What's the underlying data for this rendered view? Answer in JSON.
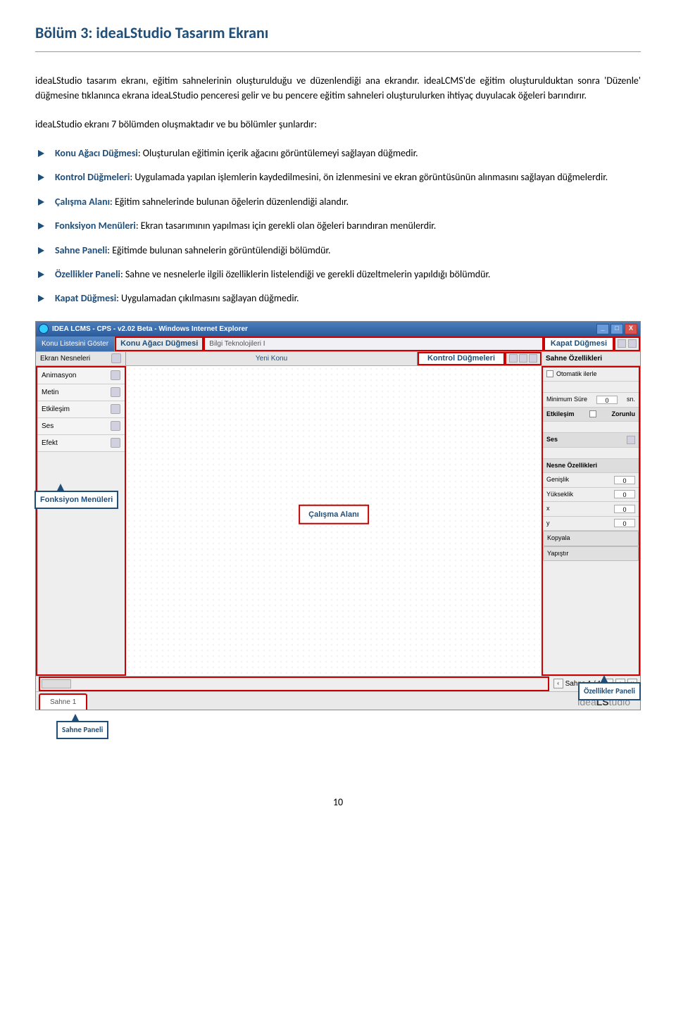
{
  "heading": "Bölüm 3: ideaLStudio Tasarım Ekranı",
  "p1": "ideaLStudio tasarım ekranı, eğitim sahnelerinin oluşturulduğu ve düzenlendiği ana ekrandır. ideaLCMS'de eğitim oluşturulduktan sonra 'Düzenle' düğmesine tıklanınca ekrana ideaLStudio penceresi gelir ve bu pencere eğitim sahneleri oluşturulurken ihtiyaç duyulacak öğeleri barındırır.",
  "p2": "ideaLStudio ekranı 7 bölümden oluşmaktadır ve bu bölümler şunlardır:",
  "items": {
    "0": {
      "term": "Konu Ağacı Düğmesi",
      "desc": ": Oluşturulan eğitimin içerik ağacını görüntülemeyi sağlayan düğmedir."
    },
    "1": {
      "term": "Kontrol Düğmeleri",
      "desc": ": Uygulamada yapılan işlemlerin kaydedilmesini, ön izlenmesini ve ekran görüntüsünün alınmasını sağlayan düğmelerdir."
    },
    "2": {
      "term": "Çalışma Alanı",
      "desc": ": Eğitim sahnelerinde bulunan öğelerin düzenlendiği alandır."
    },
    "3": {
      "term": "Fonksiyon Menüleri",
      "desc": ": Ekran tasarımının yapılması için gerekli olan öğeleri barındıran menülerdir."
    },
    "4": {
      "term": "Sahne Paneli",
      "desc": ": Eğitimde bulunan sahnelerin görüntülendiği bölümdür."
    },
    "5": {
      "term": "Özellikler Paneli",
      "desc": ": Sahne ve nesnelerle ilgili özelliklerin listelendiği ve gerekli düzeltmelerin yapıldığı bölümdür."
    },
    "6": {
      "term": "Kapat Düğmesi",
      "desc": ": Uygulamadan çıkılmasını sağlayan düğmedir."
    }
  },
  "win": {
    "title": "IDEA LCMS - CPS - v2.02 Beta - Windows Internet Explorer",
    "min": "_",
    "max": "□",
    "close": "X"
  },
  "tb1": {
    "konu_liste": "Konu Listesini Göster",
    "konu_agaci": "Konu Ağacı Düğmesi",
    "bilgi": "Bilgi Teknolojileri I",
    "kapat": "Kapat Düğmesi"
  },
  "tb2": {
    "ekran": "Ekran Nesneleri",
    "yeni": "Yeni Konu",
    "kontrol": "Kontrol Düğmeleri",
    "sahne_oz": "Sahne Özellikleri"
  },
  "side": {
    "0": "Animasyon",
    "1": "Metin",
    "2": "Etkileşim",
    "3": "Ses",
    "4": "Efekt"
  },
  "canvas_label": "Çalışma Alanı",
  "rp": {
    "otomatik": "Otomatik ilerle",
    "min_sure": "Minimum Süre",
    "min_sure_val": "0",
    "sn": "sn.",
    "etkilesim": "Etkileşim",
    "zorunlu": "Zorunlu",
    "ses": "Ses",
    "nesne": "Nesne Özellikleri",
    "gen": "Genişlik",
    "gen_v": "0",
    "yuk": "Yükseklik",
    "yuk_v": "0",
    "x": "x",
    "x_v": "0",
    "y": "y",
    "y_v": "0",
    "kopyala": "Kopyala",
    "yapistir": "Yapıştır"
  },
  "bottom": {
    "sahne": "Sahne",
    "page": "1 / 1",
    "back": "‹",
    "fwd": "›",
    "add": "+",
    "del": "×"
  },
  "tab": {
    "sahne1": "Sahne 1"
  },
  "logo": {
    "pre": "idea",
    "bold": "LS",
    "post": "tudio"
  },
  "annot": {
    "fonksiyon": "Fonksiyon Menüleri",
    "ozellikler": "Özellikler Paneli",
    "sahne": "Sahne Paneli"
  },
  "page_num": "10"
}
